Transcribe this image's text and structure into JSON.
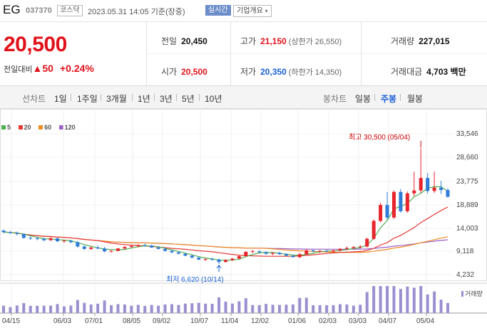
{
  "header": {
    "name": "EG",
    "code": "037370",
    "market": "코스닥",
    "datetime": "2023.05.31 14:05",
    "basis": "기준(장중)",
    "realtime": "실시간",
    "company_info": "기업개요"
  },
  "quote": {
    "price": "20,500",
    "change_label": "전일대비",
    "change_amount": "50",
    "change_pct": "+0.24%",
    "prev_label": "전일",
    "prev": "20,450",
    "open_label": "시가",
    "open": "20,500",
    "high_label": "고가",
    "high": "21,150",
    "upper_limit": "(상한가 26,550)",
    "low_label": "저가",
    "low": "20,350",
    "lower_limit": "(하한가 14,350)",
    "volume_label": "거래량",
    "volume": "227,015",
    "amount_label": "거래대금",
    "amount": "4,703",
    "amount_unit": "백만"
  },
  "tabs": {
    "line_label": "선차트",
    "line_items": [
      "1일",
      "1주일",
      "3개월",
      "1년",
      "3년",
      "5년",
      "10년"
    ],
    "candle_label": "봉차트",
    "candle_items": [
      "일봉",
      "주봉",
      "월봉"
    ],
    "candle_active": "주봉"
  },
  "chart_data": {
    "type": "candlestick",
    "ma_legend": [
      {
        "name": "5",
        "color": "#4caf50"
      },
      {
        "name": "20",
        "color": "#e53935"
      },
      {
        "name": "60",
        "color": "#f08c1e"
      },
      {
        "name": "120",
        "color": "#9c5dc9"
      }
    ],
    "y_ticks": [
      "33,546",
      "28,660",
      "23,775",
      "18,889",
      "14,003",
      "9,118",
      "4,232"
    ],
    "ylim": [
      4232,
      33546
    ],
    "x_ticks": [
      "04/15",
      "06/03",
      "07/01",
      "08/05",
      "09/02",
      "10/07",
      "11/04",
      "12/02",
      "01/06",
      "02/03",
      "03/03",
      "04/07",
      "05/04"
    ],
    "high_annotation": "최고 30,500 (05/04)",
    "low_annotation": "최저 6,620 (10/14)",
    "volume_label": "거래량",
    "candles": [
      [
        13500,
        13700,
        12900,
        13200
      ],
      [
        13200,
        13400,
        12800,
        13000
      ],
      [
        13000,
        13300,
        12500,
        12800
      ],
      [
        12800,
        12900,
        11800,
        12000
      ],
      [
        12000,
        12300,
        11600,
        11900
      ],
      [
        11900,
        12200,
        11500,
        11800
      ],
      [
        11800,
        12000,
        11300,
        11500
      ],
      [
        11500,
        12100,
        11400,
        11900
      ],
      [
        11900,
        12000,
        11100,
        11300
      ],
      [
        11300,
        11600,
        11000,
        11400
      ],
      [
        11400,
        11600,
        10900,
        11100
      ],
      [
        11100,
        11300,
        10000,
        10200
      ],
      [
        10200,
        10400,
        9500,
        9700
      ],
      [
        9700,
        10200,
        9500,
        10000
      ],
      [
        10000,
        10400,
        9600,
        9800
      ],
      [
        9800,
        10100,
        9000,
        9200
      ],
      [
        9200,
        9500,
        8900,
        9300
      ],
      [
        9300,
        9900,
        9200,
        9800
      ],
      [
        9800,
        10300,
        9600,
        10100
      ],
      [
        10100,
        10500,
        9900,
        10300
      ],
      [
        10300,
        10700,
        10000,
        10500
      ],
      [
        10500,
        10800,
        10200,
        10400
      ],
      [
        10400,
        10600,
        9900,
        10000
      ],
      [
        10000,
        10200,
        9600,
        9700
      ],
      [
        9700,
        9900,
        9200,
        9300
      ],
      [
        9300,
        9500,
        8800,
        9000
      ],
      [
        9000,
        9200,
        8600,
        8700
      ],
      [
        8700,
        8900,
        8200,
        8300
      ],
      [
        8300,
        8500,
        7800,
        7900
      ],
      [
        7900,
        8100,
        7400,
        7500
      ],
      [
        7500,
        7800,
        7200,
        7600
      ],
      [
        7600,
        7900,
        7300,
        7500
      ],
      [
        7500,
        7700,
        6620,
        7000
      ],
      [
        7000,
        7600,
        6900,
        7400
      ],
      [
        7400,
        7800,
        7200,
        7700
      ],
      [
        7700,
        8400,
        7600,
        8200
      ],
      [
        8200,
        9200,
        8100,
        9100
      ],
      [
        9100,
        9500,
        8900,
        9200
      ],
      [
        9200,
        9400,
        8800,
        9000
      ],
      [
        9000,
        9200,
        8500,
        8700
      ],
      [
        8700,
        9000,
        8400,
        8900
      ],
      [
        8900,
        9100,
        8500,
        8600
      ],
      [
        8600,
        8800,
        8200,
        8300
      ],
      [
        8300,
        8500,
        7900,
        8000
      ],
      [
        8000,
        8900,
        7800,
        8600
      ],
      [
        8600,
        9700,
        8500,
        9400
      ],
      [
        9400,
        9600,
        9000,
        9200
      ],
      [
        9200,
        9500,
        8900,
        9300
      ],
      [
        9300,
        9600,
        9000,
        9200
      ],
      [
        9200,
        9500,
        8900,
        9400
      ],
      [
        9400,
        9900,
        9200,
        9700
      ],
      [
        9700,
        10200,
        9500,
        9900
      ],
      [
        9900,
        10300,
        9700,
        10100
      ],
      [
        10100,
        10500,
        9800,
        10200
      ],
      [
        10200,
        12000,
        10000,
        11800
      ],
      [
        11800,
        15800,
        11600,
        15500
      ],
      [
        15500,
        19300,
        15200,
        18800
      ],
      [
        18800,
        21500,
        15700,
        16200
      ],
      [
        16200,
        21800,
        15900,
        21500
      ],
      [
        21500,
        22100,
        17200,
        17500
      ],
      [
        17500,
        21600,
        17200,
        21200
      ],
      [
        21200,
        25700,
        20600,
        21800
      ],
      [
        21800,
        30500,
        21300,
        24400
      ],
      [
        24400,
        25400,
        21200,
        21700
      ],
      [
        21700,
        25700,
        21300,
        22400
      ],
      [
        22400,
        23800,
        21100,
        21900
      ],
      [
        21900,
        22200,
        20300,
        20500
      ]
    ]
  }
}
